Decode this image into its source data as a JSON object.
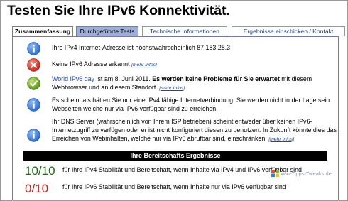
{
  "page": {
    "title": "Testen Sie Ihre IPv6 Konnektivität."
  },
  "tabs": [
    {
      "label": "Zusammenfassung"
    },
    {
      "label": "Durchgeführte Tests"
    },
    {
      "label": "Technische Informationen"
    },
    {
      "label": "Ergebnisse einschicken / Kontakt"
    }
  ],
  "rows": {
    "ipv4": {
      "text": "Ihre IPv4 Internet-Adresse ist höchstwahrscheinlich 87.183.28.3",
      "icon": "info-icon"
    },
    "ipv6": {
      "text": "Keine IPv6 Adresse erkannt",
      "more": "[mehr Infos]",
      "icon": "error-icon"
    },
    "ipv6day": {
      "link": "World IPv6 day",
      "text1": "ist am 8. Juni 2011.",
      "bold": "Es werden keine Probleme für Sie erwartet",
      "text2": "mit diesem Webbrowser und an diesem Standort.",
      "more": "[mehr Infos]",
      "icon": "checkmark-icon"
    },
    "ipv4only": {
      "text": "Es scheint als hätten Sie nur eine IPv4 fähige Internetverbindung. Sie werden nicht in der Lage sein Webseiten welche nur via IPv6 verfügbar sind zu erreichen.",
      "icon": "info-icon"
    },
    "dns": {
      "text": "Ihr DNS Server (wahrscheinlich von Ihrem ISP betrieben) scheint entweder über keinen IPv6-Internetzugriff zu verfügen oder er ist nicht konfiguriert diesen zu benutzen. In Zukunft könnte dies das Erreichen von Webinhalten, welche nur via IPv6 abrufbar sind, einschränken.",
      "more": "[mehr Infos]",
      "icon": "info-icon"
    }
  },
  "results": {
    "heading": "Ihre Bereitschafts Ergebnisse",
    "ipv4_score": "10/10",
    "ipv4_text": "für Ihre IPv4 Stabilität und Bereitschaft, wenn Inhalte via IPv4 und IPv6 verfügbar sind",
    "ipv6_score": "0/10",
    "ipv6_text": "für Ihre IPv6 Stabilität und Bereitschaft, wenn Inhalte nur via IPv6 verfügbar sind"
  },
  "watermark": "Win-Tipps-Tweaks.de",
  "colors": {
    "info": "#2e6fd6",
    "error": "#d62b1e",
    "ok": "#6aa122",
    "score_good": "#1c6b12",
    "score_bad": "#cc1c14",
    "active_tab": "#9eaed8"
  }
}
